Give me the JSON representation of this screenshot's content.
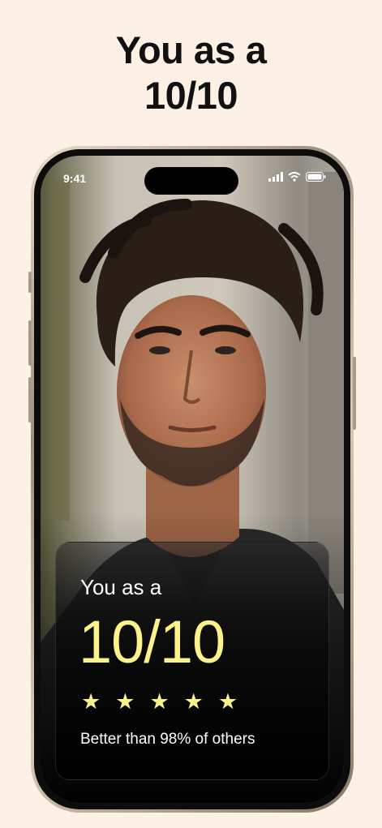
{
  "headline": {
    "line1": "You as a",
    "line2": "10/10"
  },
  "status_bar": {
    "time": "9:41",
    "icons": [
      "signal-icon",
      "wifi-icon",
      "battery-icon"
    ]
  },
  "rating_card": {
    "subtitle": "You as a",
    "score": "10/10",
    "stars_filled": 5,
    "stars_total": 5,
    "caption": "Better than 98% of others"
  },
  "colors": {
    "background": "#fdf1e6",
    "score_accent": "#fdf38a"
  }
}
